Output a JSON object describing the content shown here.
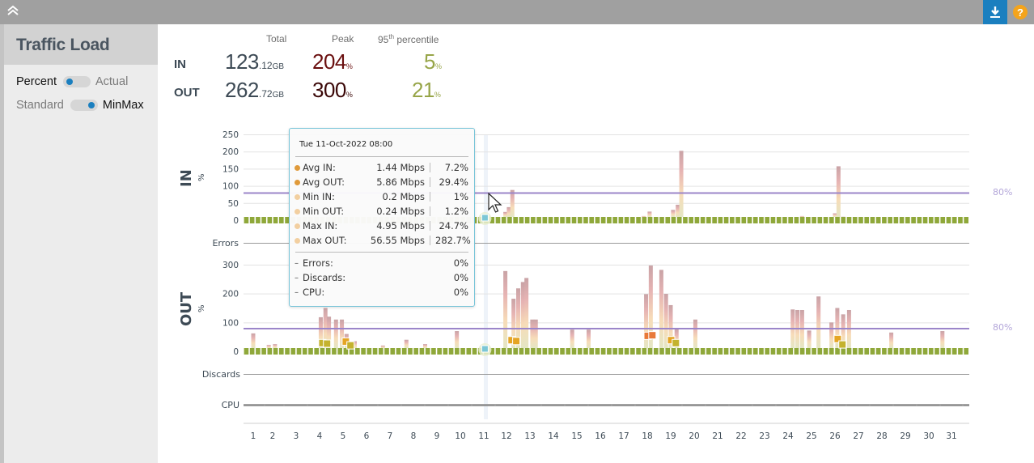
{
  "topbar": {
    "collapse_icon": "double-chevron-up-icon",
    "download_icon": "download-icon",
    "help_label": "?",
    "colors": {
      "bar": "#a0a0a0",
      "download": "#1a7fbf",
      "help": "#f4a41c"
    }
  },
  "sidebar": {
    "title": "Traffic Load",
    "toggles": [
      {
        "left": "Percent",
        "right": "Actual",
        "selected": "left"
      },
      {
        "left": "Standard",
        "right": "MinMax",
        "selected": "right"
      }
    ]
  },
  "summary": {
    "headers": {
      "total": "Total",
      "peak": "Peak",
      "p95_prefix": "95",
      "p95_sup": "th",
      "p95_suffix": " percentile"
    },
    "rows": [
      {
        "label": "IN",
        "total_int": "123",
        "total_dec": ".12",
        "total_unit": "GB",
        "peak": "204",
        "peak_unit": "%",
        "p95": "5",
        "p95_unit": "%"
      },
      {
        "label": "OUT",
        "total_int": "262",
        "total_dec": ".72",
        "total_unit": "GB",
        "peak": "300",
        "peak_unit": "%",
        "p95": "21",
        "p95_unit": "%"
      }
    ]
  },
  "tooltip": {
    "title": "Tue 11-Oct-2022 08:00",
    "rows": [
      {
        "name": "Avg IN:",
        "value": "1.44 Mbps",
        "pct": "7.2%",
        "dot": "#e09a3a"
      },
      {
        "name": "Avg OUT:",
        "value": "5.86 Mbps",
        "pct": "29.4%",
        "dot": "#e09a3a"
      },
      {
        "name": "Min IN:",
        "value": "0.2 Mbps",
        "pct": "1%",
        "dot": "#f2cfa0"
      },
      {
        "name": "Min OUT:",
        "value": "0.24 Mbps",
        "pct": "1.2%",
        "dot": "#f2cfa0"
      },
      {
        "name": "Max IN:",
        "value": "4.95 Mbps",
        "pct": "24.7%",
        "dot": "#f2cfa0"
      },
      {
        "name": "Max OUT:",
        "value": "56.55 Mbps",
        "pct": "282.7%",
        "dot": "#f2cfa0"
      }
    ],
    "extra": [
      {
        "name": "Errors:",
        "pct": "0%"
      },
      {
        "name": "Discards:",
        "pct": "0%"
      },
      {
        "name": "CPU:",
        "pct": "0%"
      }
    ]
  },
  "chart_data": [
    {
      "type": "bar",
      "title": "IN",
      "ylabel": "%",
      "ylim": [
        0,
        250
      ],
      "yticks": [
        "250",
        "200",
        "150",
        "100",
        "50",
        "0"
      ],
      "threshold": {
        "value": 80,
        "label": "80%",
        "color": "#9b85c9"
      },
      "x_categories": [
        "1",
        "2",
        "3",
        "4",
        "5",
        "6",
        "7",
        "8",
        "9",
        "10",
        "11",
        "12",
        "13",
        "14",
        "15",
        "16",
        "17",
        "18",
        "19",
        "20",
        "21",
        "22",
        "23",
        "24",
        "25",
        "26",
        "27",
        "28",
        "29",
        "30",
        "31"
      ],
      "max_spikes": [
        {
          "day": 11.95,
          "value": 24
        },
        {
          "day": 12.1,
          "value": 38
        },
        {
          "day": 12.25,
          "value": 88
        },
        {
          "day": 17.85,
          "value": 12
        },
        {
          "day": 18.1,
          "value": 25
        },
        {
          "day": 19.1,
          "value": 30
        },
        {
          "day": 19.3,
          "value": 45
        },
        {
          "day": 19.45,
          "value": 202
        },
        {
          "day": 24.6,
          "value": 12
        },
        {
          "day": 26.0,
          "value": 20
        },
        {
          "day": 26.15,
          "value": 157
        },
        {
          "day": 26.35,
          "value": 10
        }
      ],
      "avg_baseline": 0,
      "errors_label": "Errors"
    },
    {
      "type": "bar",
      "title": "OUT",
      "ylabel": "%",
      "ylim": [
        0,
        300
      ],
      "yticks": [
        "300",
        "200",
        "100",
        "0"
      ],
      "threshold": {
        "value": 80,
        "label": "80%",
        "color": "#9b85c9"
      },
      "x_categories": [
        "1",
        "2",
        "3",
        "4",
        "5",
        "6",
        "7",
        "8",
        "9",
        "10",
        "11",
        "12",
        "13",
        "14",
        "15",
        "16",
        "17",
        "18",
        "19",
        "20",
        "21",
        "22",
        "23",
        "24",
        "25",
        "26",
        "27",
        "28",
        "29",
        "30",
        "31"
      ],
      "max_spikes": [
        {
          "day": 0.8,
          "value": 62
        },
        {
          "day": 1.8,
          "value": 22
        },
        {
          "day": 2.1,
          "value": 25
        },
        {
          "day": 4.05,
          "value": 118
        },
        {
          "day": 4.25,
          "value": 150
        },
        {
          "day": 4.4,
          "value": 120
        },
        {
          "day": 4.7,
          "value": 110
        },
        {
          "day": 4.95,
          "value": 110
        },
        {
          "day": 5.15,
          "value": 60
        },
        {
          "day": 5.5,
          "value": 35
        },
        {
          "day": 6.7,
          "value": 20
        },
        {
          "day": 7.7,
          "value": 40
        },
        {
          "day": 8.5,
          "value": 25
        },
        {
          "day": 9.85,
          "value": 70
        },
        {
          "day": 11.95,
          "value": 278
        },
        {
          "day": 12.3,
          "value": 182
        },
        {
          "day": 12.5,
          "value": 218
        },
        {
          "day": 12.7,
          "value": 240
        },
        {
          "day": 12.85,
          "value": 254
        },
        {
          "day": 13.1,
          "value": 110
        },
        {
          "day": 13.25,
          "value": 110
        },
        {
          "day": 14.8,
          "value": 75
        },
        {
          "day": 15.5,
          "value": 75
        },
        {
          "day": 17.95,
          "value": 198
        },
        {
          "day": 18.15,
          "value": 297
        },
        {
          "day": 18.6,
          "value": 282
        },
        {
          "day": 18.8,
          "value": 199
        },
        {
          "day": 19.0,
          "value": 160
        },
        {
          "day": 19.25,
          "value": 78
        },
        {
          "day": 20.05,
          "value": 110
        },
        {
          "day": 24.2,
          "value": 145
        },
        {
          "day": 24.4,
          "value": 143
        },
        {
          "day": 24.6,
          "value": 143
        },
        {
          "day": 24.9,
          "value": 72
        },
        {
          "day": 25.3,
          "value": 190
        },
        {
          "day": 25.85,
          "value": 100
        },
        {
          "day": 26.1,
          "value": 150
        },
        {
          "day": 26.35,
          "value": 128
        },
        {
          "day": 26.6,
          "value": 143
        },
        {
          "day": 28.4,
          "value": 65
        },
        {
          "day": 30.6,
          "value": 70
        }
      ],
      "avg_markers": [
        {
          "day": 4.1,
          "value": 30
        },
        {
          "day": 4.3,
          "value": 28
        },
        {
          "day": 5.1,
          "value": 35
        },
        {
          "day": 5.3,
          "value": 22
        },
        {
          "day": 12.2,
          "value": 40
        },
        {
          "day": 12.4,
          "value": 37
        },
        {
          "day": 18.0,
          "value": 55
        },
        {
          "day": 18.2,
          "value": 57
        },
        {
          "day": 19.0,
          "value": 40
        },
        {
          "day": 19.2,
          "value": 30
        },
        {
          "day": 26.1,
          "value": 44
        },
        {
          "day": 26.3,
          "value": 25
        }
      ],
      "discards_label": "Discards",
      "cpu_label": "CPU"
    }
  ],
  "hover_day": 11
}
